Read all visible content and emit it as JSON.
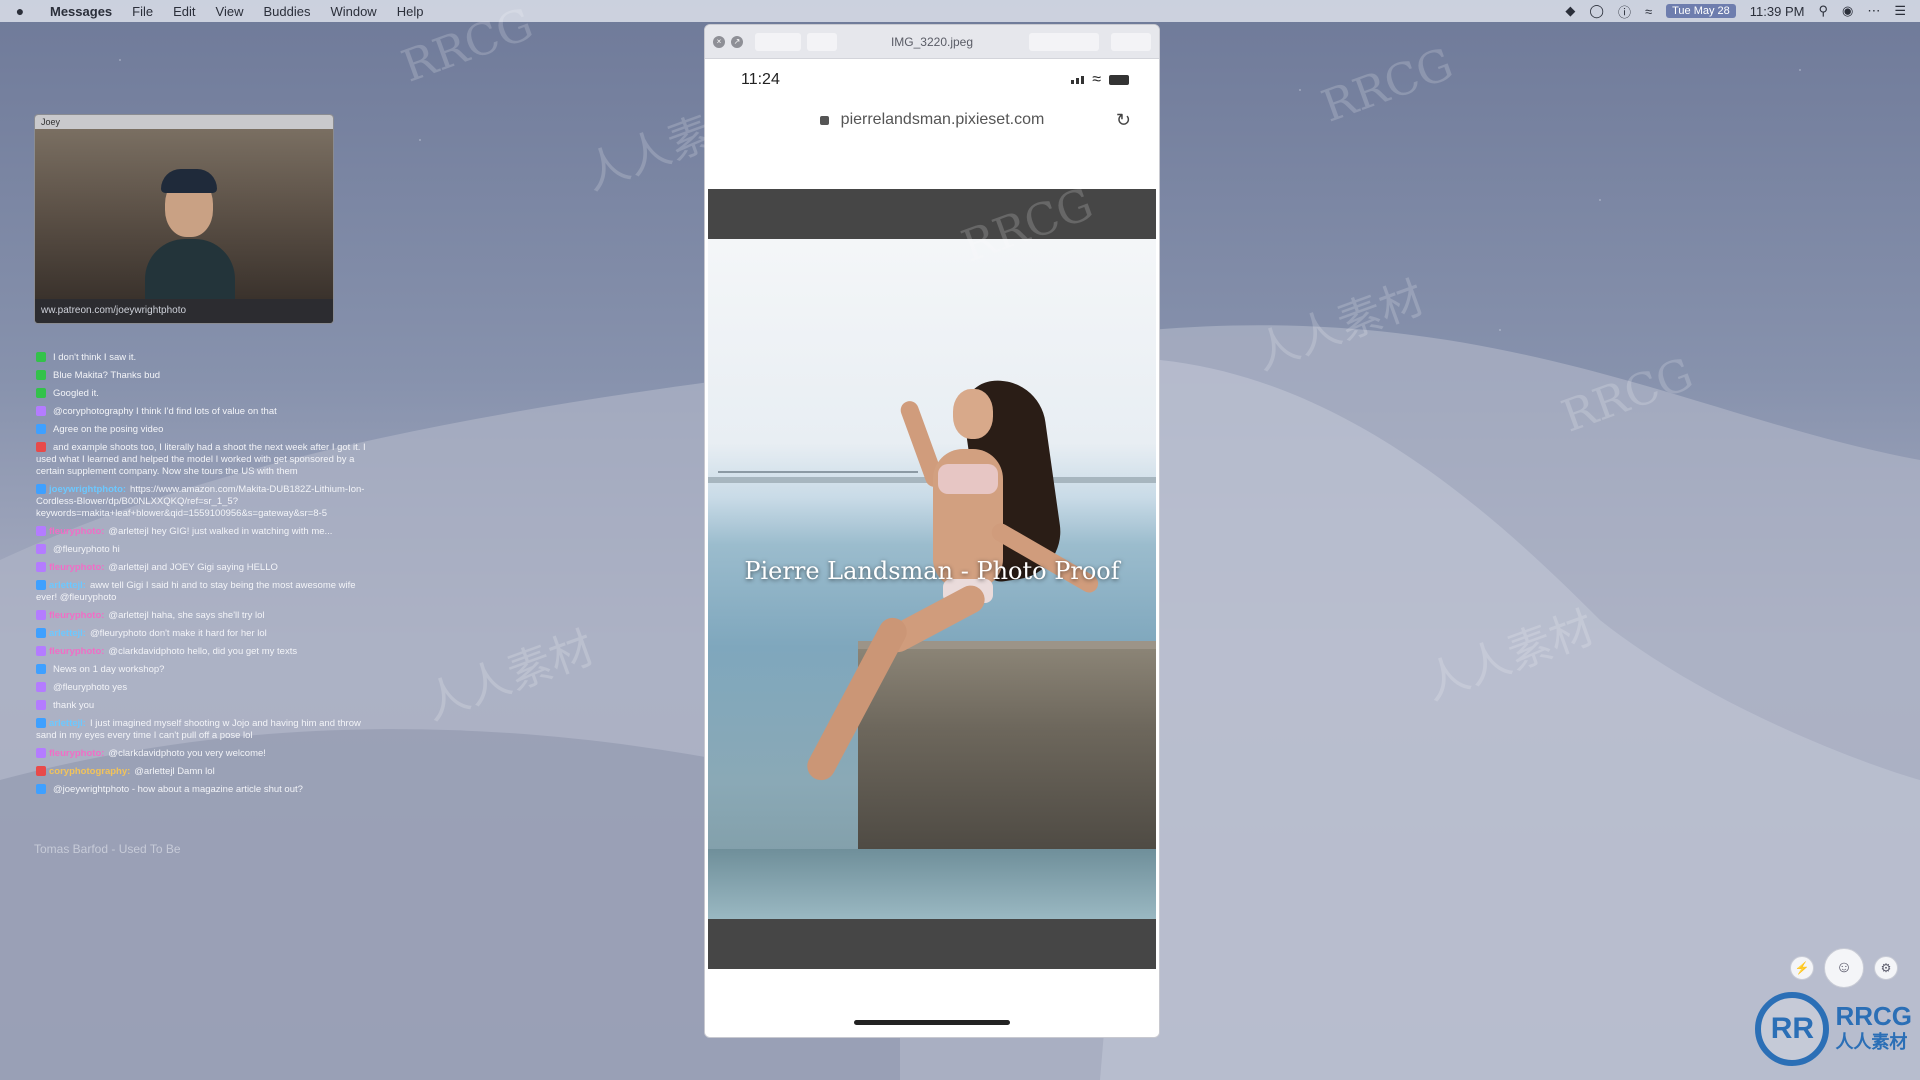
{
  "menubar": {
    "app": "Messages",
    "items": [
      "File",
      "Edit",
      "View",
      "Buddies",
      "Window",
      "Help"
    ],
    "date": "Tue May 28",
    "time": "11:39 PM"
  },
  "video_window": {
    "title": "Joey",
    "footer": "ww.patreon.com/joeywrightphoto"
  },
  "chat": [
    {
      "user": "",
      "color": "green",
      "text": "I don't think I saw it."
    },
    {
      "user": "",
      "color": "green",
      "text": "Blue Makita? Thanks bud"
    },
    {
      "user": "",
      "color": "green",
      "text": "Googled it."
    },
    {
      "user": "",
      "color": "pink",
      "text": "@coryphotography I think I'd find lots of value on that"
    },
    {
      "user": "",
      "color": "blue",
      "text": "Agree on the posing video"
    },
    {
      "user": "",
      "color": "gold",
      "text": "and example shoots too, I literally had a shoot the next week after I got it. I used what I learned and helped the model I worked with get sponsored by a certain supplement company. Now she tours the US with them"
    },
    {
      "user": "joeywrightphoto:",
      "color": "blue",
      "text": "https://www.amazon.com/Makita-DUB182Z-Lithium-Ion-Cordless-Blower/dp/B00NLXXQKQ/ref=sr_1_5?keywords=makita+leaf+blower&qid=1559100956&s=gateway&sr=8-5"
    },
    {
      "user": "fleuryphoto:",
      "color": "pink",
      "text": "@arlettejl hey GIG! just walked in watching with me..."
    },
    {
      "user": "",
      "color": "pink",
      "text": "@fleuryphoto hi"
    },
    {
      "user": "fleuryphoto:",
      "color": "pink",
      "text": "@arlettejl and JOEY Gigi saying HELLO"
    },
    {
      "user": "arlettejl:",
      "color": "blue",
      "text": "aww tell Gigi I said hi and to stay being the most awesome wife ever! @fleuryphoto"
    },
    {
      "user": "fleuryphoto:",
      "color": "pink",
      "text": "@arlettejl haha, she says she'll try lol"
    },
    {
      "user": "arlettejl:",
      "color": "blue",
      "text": "@fleuryphoto don't make it hard for her lol"
    },
    {
      "user": "fleuryphoto:",
      "color": "pink",
      "text": "@clarkdavidphoto hello, did you get my texts"
    },
    {
      "user": "",
      "color": "blue",
      "text": "News on 1 day workshop?"
    },
    {
      "user": "",
      "color": "pink",
      "text": "@fleuryphoto yes"
    },
    {
      "user": "",
      "color": "pink",
      "text": "thank you"
    },
    {
      "user": "arlettejl:",
      "color": "blue",
      "text": "I just imagined myself shooting w Jojo and having him and throw sand in my eyes every time I can't pull off a pose lol"
    },
    {
      "user": "fleuryphoto:",
      "color": "pink",
      "text": "@clarkdavidphoto you very welcome!"
    },
    {
      "user": "coryphotography:",
      "color": "gold",
      "text": "@arlettejl Damn lol"
    },
    {
      "user": "",
      "color": "blue",
      "text": "@joeywrightphoto - how about a magazine article shut out?"
    }
  ],
  "now_playing": "Tomas Barfod - Used To Be",
  "viewer": {
    "title": "IMG_3220.jpeg",
    "status_time": "11:24",
    "url": "pierrelandsman.pixieset.com",
    "overlay_title": "Pierre Landsman - Photo Proof"
  },
  "logo": {
    "mark": "RR",
    "name": "RRCG",
    "sub": "人人素材"
  },
  "watermarks": [
    "RRCG",
    "人人素材",
    "RRCG",
    "人人素材",
    "RRCG",
    "人人素材",
    "RRCG",
    "人人素材"
  ]
}
